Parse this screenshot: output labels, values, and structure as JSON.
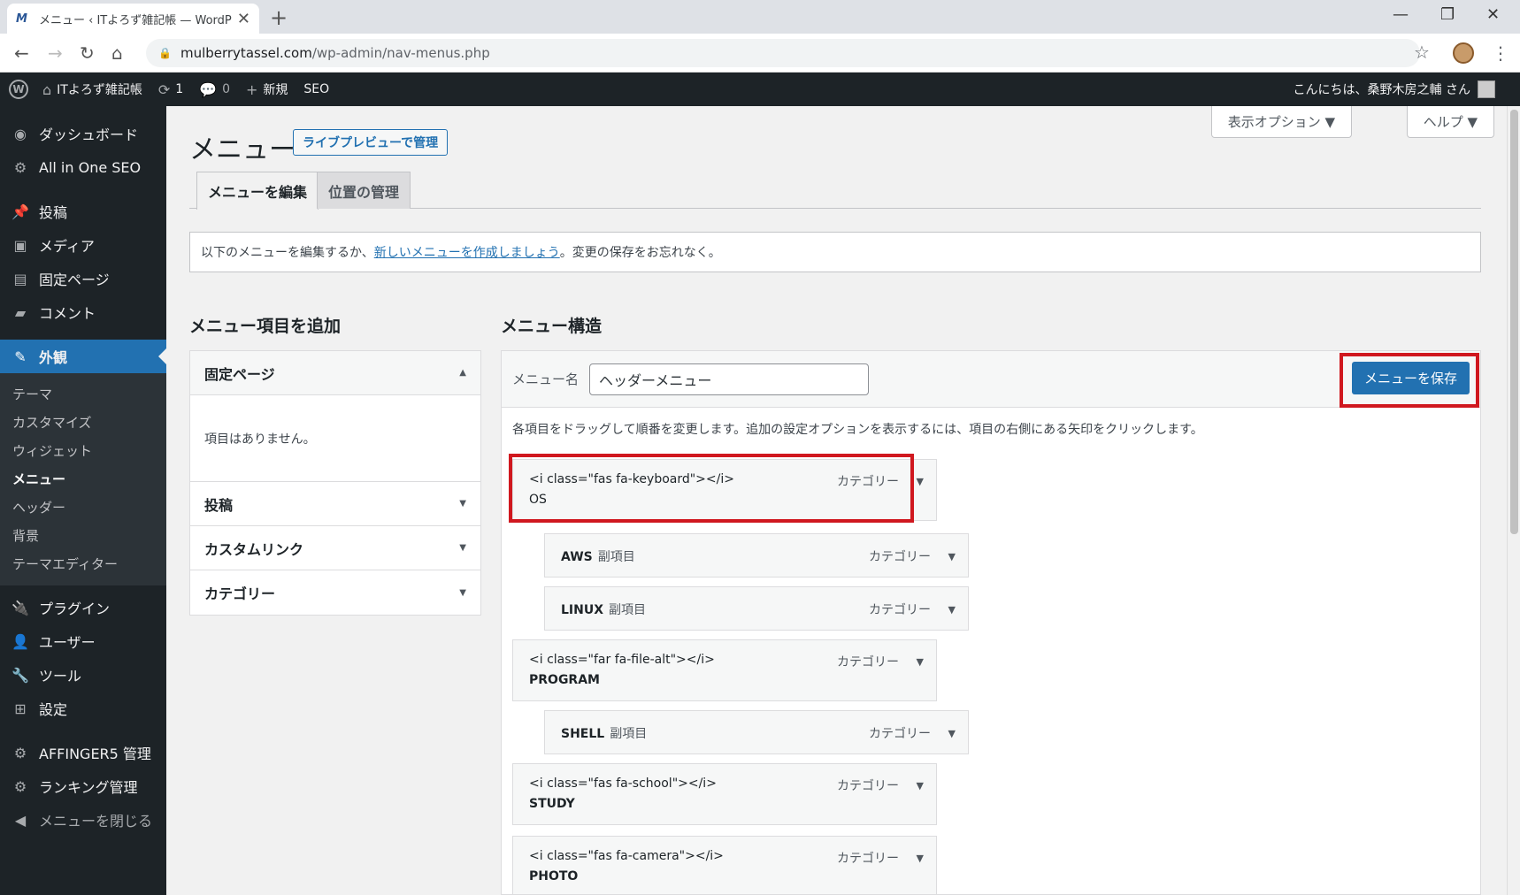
{
  "browser": {
    "tab_title": "メニュー ‹ ITよろず雑記帳 — WordPr",
    "url_host": "mulberrytassel.com",
    "url_path": "/wp-admin/nav-menus.php"
  },
  "adminbar": {
    "site_name": "ITよろず雑記帳",
    "updates_count": "1",
    "comments_count": "0",
    "new_label": "新規",
    "seo_label": "SEO",
    "greeting": "こんにちは、桑野木房之輔 さん"
  },
  "sidebar": {
    "items": [
      {
        "label": "ダッシュボード"
      },
      {
        "label": "All in One SEO"
      },
      {
        "label": "投稿"
      },
      {
        "label": "メディア"
      },
      {
        "label": "固定ページ"
      },
      {
        "label": "コメント"
      },
      {
        "label": "外観"
      },
      {
        "label": "プラグイン"
      },
      {
        "label": "ユーザー"
      },
      {
        "label": "ツール"
      },
      {
        "label": "設定"
      },
      {
        "label": "AFFINGER5 管理"
      },
      {
        "label": "ランキング管理"
      },
      {
        "label": "メニューを閉じる"
      }
    ],
    "submenu": [
      "テーマ",
      "カスタマイズ",
      "ウィジェット",
      "メニュー",
      "ヘッダー",
      "背景",
      "テーマエディター"
    ]
  },
  "header": {
    "screen_options": "表示オプション ▼",
    "help": "ヘルプ ▼",
    "title": "メニュー",
    "live_preview": "ライブプレビューで管理"
  },
  "tabs": {
    "edit": "メニューを編集",
    "locations": "位置の管理"
  },
  "notice": {
    "before": "以下のメニューを編集するか、",
    "link": "新しいメニューを作成しましょう",
    "after": "。変更の保存をお忘れなく。"
  },
  "add_items": {
    "heading": "メニュー項目を追加",
    "pages_title": "固定ページ",
    "pages_empty": "項目はありません。",
    "posts_title": "投稿",
    "custom_title": "カスタムリンク",
    "cat_title": "カテゴリー"
  },
  "structure": {
    "heading": "メニュー構造",
    "name_label": "メニュー名",
    "name_value": "ヘッダーメニュー",
    "save_label": "メニューを保存",
    "instructions": "各項目をドラッグして順番を変更します。追加の設定オプションを表示するには、項目の右側にある矢印をクリックします。",
    "type_label": "カテゴリー",
    "sub_label": "副項目",
    "items": [
      {
        "code": "<i class=\"fas fa-keyboard\"></i>",
        "name": "OS"
      },
      {
        "name": "AWS"
      },
      {
        "name": "LINUX"
      },
      {
        "code": "<i class=\"far fa-file-alt\"></i>",
        "name": "PROGRAM"
      },
      {
        "name": "SHELL"
      },
      {
        "code": "<i class=\"fas fa-school\"></i>",
        "name": "STUDY"
      },
      {
        "code": "<i class=\"fas fa-camera\"></i>",
        "name": "PHOTO"
      }
    ]
  }
}
